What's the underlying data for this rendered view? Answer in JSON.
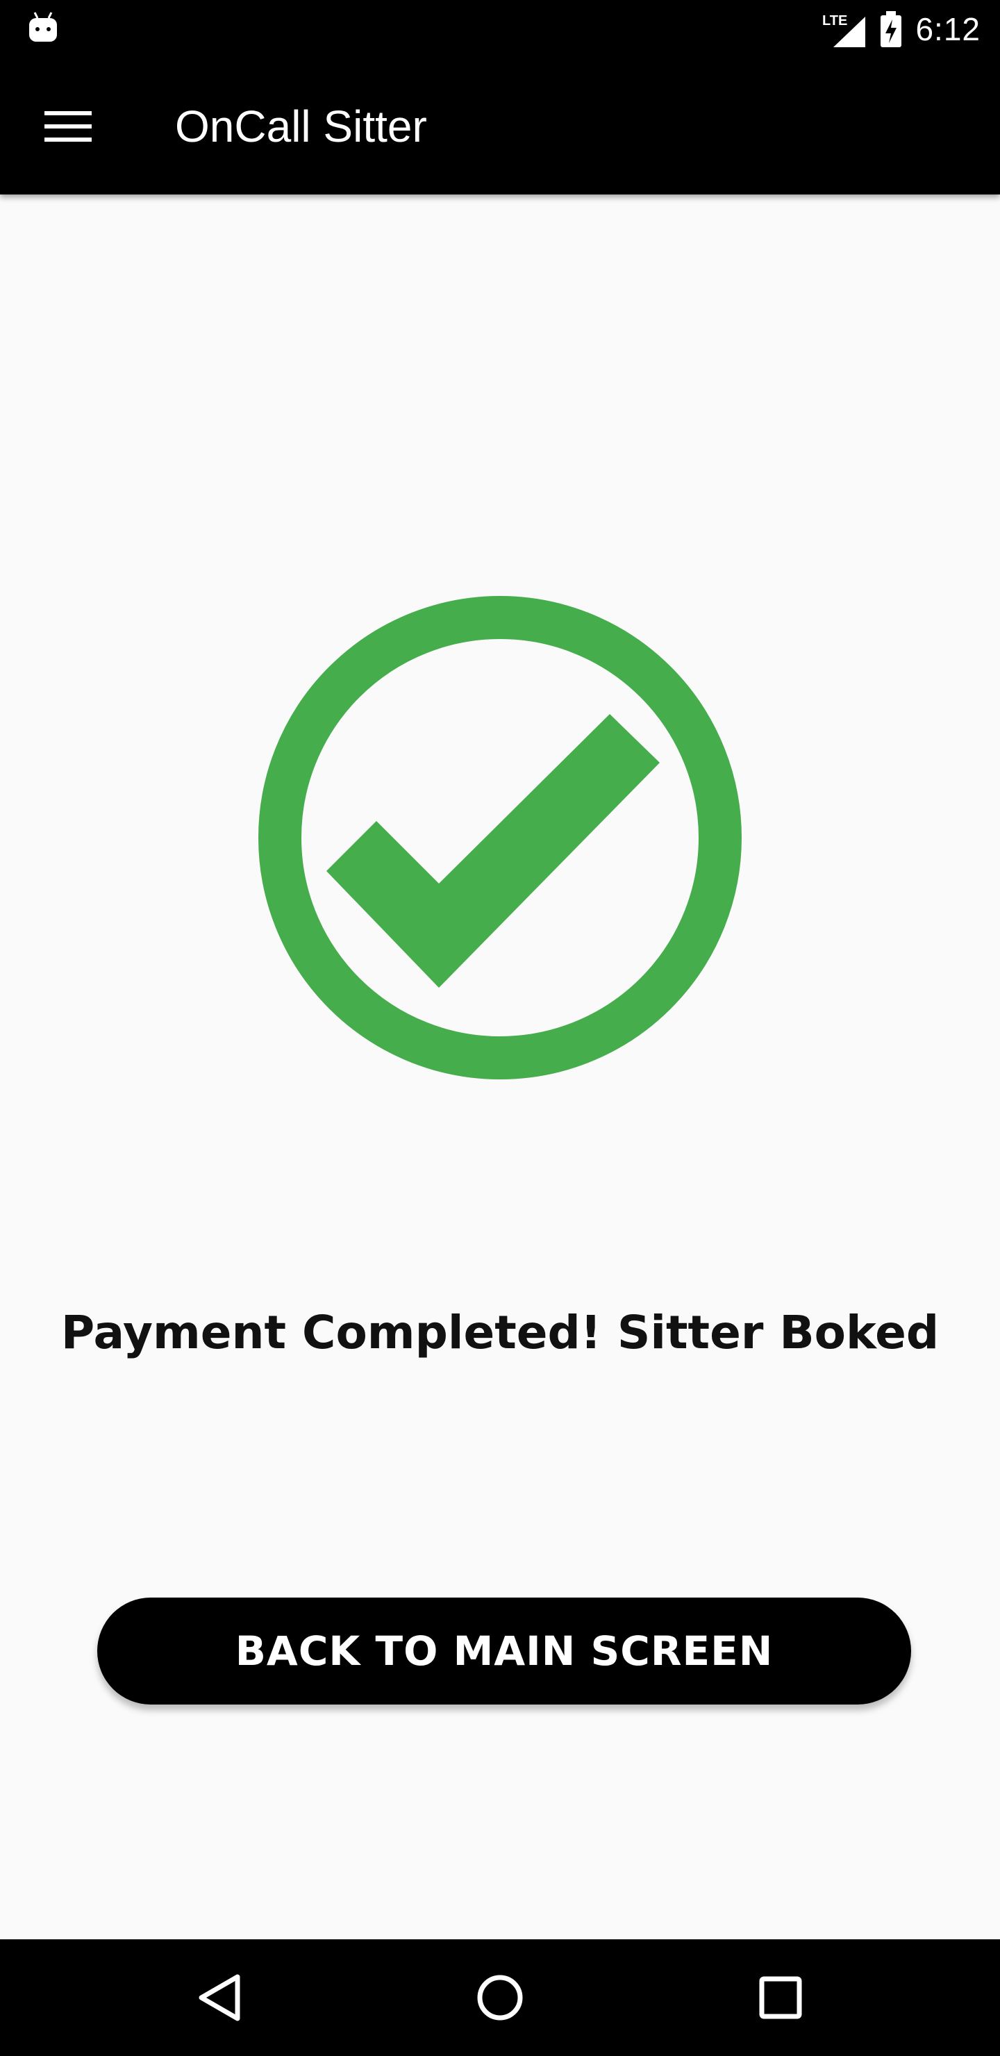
{
  "status_bar": {
    "network": "LTE",
    "time": "6:12"
  },
  "app_bar": {
    "title": "OnCall Sitter",
    "menu_icon": "hamburger-menu-icon"
  },
  "main": {
    "icon": "check-circle-icon",
    "icon_color": "#45ad4b",
    "message": "Payment Completed! Sitter Boked",
    "back_button_label": "BACK TO MAIN SCREEN"
  },
  "nav_bar": {
    "back_icon": "back-triangle-icon",
    "home_icon": "home-circle-icon",
    "recents_icon": "recents-square-icon"
  }
}
